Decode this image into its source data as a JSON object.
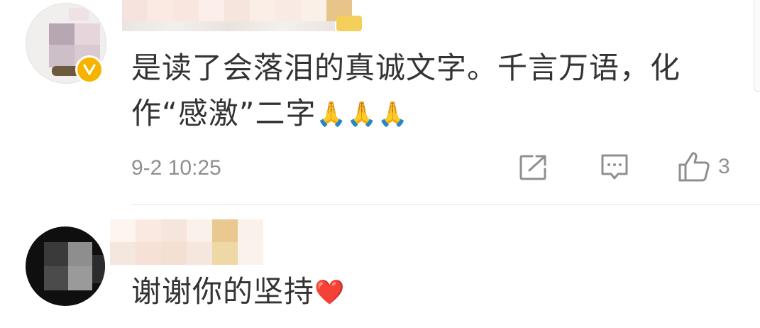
{
  "comments": [
    {
      "text_line1": "是读了会落泪的真诚文字。千言万语，化",
      "text_line2_prefix": "作“感激”二字",
      "emojis": [
        "🙏",
        "🙏",
        "🙏"
      ],
      "timestamp": "9-2 10:25",
      "like_count": "3",
      "verified": true
    },
    {
      "text": "谢谢你的坚持",
      "emoji": "❤️"
    }
  ],
  "icons": {
    "share": "share-icon",
    "reply": "comment-icon",
    "like": "thumbs-up-icon",
    "verified": "verified-v-icon"
  },
  "colors": {
    "text": "#333333",
    "meta": "#8f8f8f",
    "verified_badge": "#f6b400"
  }
}
